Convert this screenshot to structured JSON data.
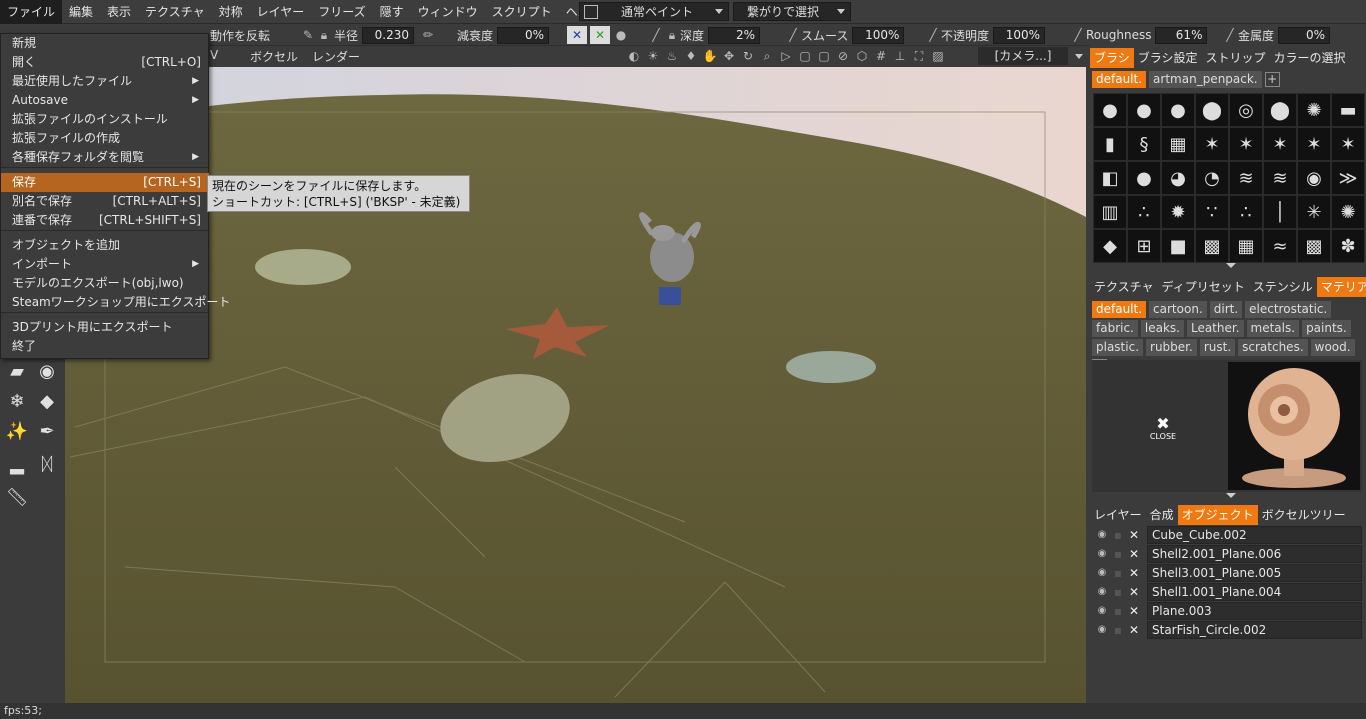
{
  "menubar": {
    "items": [
      "ファイル",
      "編集",
      "表示",
      "テクスチャ",
      "対称",
      "レイヤー",
      "フリーズ",
      "隠す",
      "ウィンドウ",
      "スクリプト",
      "ヘルプ"
    ],
    "paint_mode": "通常ペイント",
    "selection_mode": "繋がりで選択"
  },
  "toolbar": {
    "partial_left": "動作を反転",
    "radius_label": "半径",
    "radius_value": "0.230",
    "falloff_label": "減衰度",
    "falloff_value": "0%",
    "depth_label": "深度",
    "depth_value": "2%",
    "smooth_label": "スムース",
    "smooth_value": "100%",
    "opacity_label": "不透明度",
    "opacity_value": "100%",
    "roughness_label": "Roughness",
    "roughness_value": "61%",
    "metal_label": "金属度",
    "metal_value": "0%"
  },
  "toolbar3": {
    "partial_uv": "V",
    "voxel": "ボクセル",
    "render": "レンダー",
    "camera": "[カメラ...]"
  },
  "file_menu": {
    "items": [
      {
        "label": "新規",
        "shortcut": ""
      },
      {
        "label": "開く",
        "shortcut": "[CTRL+O]"
      },
      {
        "label": "最近使用したファイル",
        "shortcut": "",
        "submenu": true
      },
      {
        "label": "Autosave",
        "shortcut": "",
        "submenu": true
      },
      {
        "label": "拡張ファイルのインストール",
        "shortcut": ""
      },
      {
        "label": "拡張ファイルの作成",
        "shortcut": ""
      },
      {
        "label": "各種保存フォルダを閲覧",
        "shortcut": "",
        "submenu": true
      },
      {
        "label": "保存",
        "shortcut": "[CTRL+S]",
        "highlighted": true
      },
      {
        "label": "別名で保存",
        "shortcut": "[CTRL+ALT+S]"
      },
      {
        "label": "連番で保存",
        "shortcut": "[CTRL+SHIFT+S]"
      },
      {
        "label": "オブジェクトを追加",
        "shortcut": ""
      },
      {
        "label": "インポート",
        "shortcut": "",
        "submenu": true
      },
      {
        "label": "モデルのエクスポート(obj,lwo)",
        "shortcut": ""
      },
      {
        "label": "Steamワークショップ用にエクスポート",
        "shortcut": ""
      },
      {
        "label": "3Dプリント用にエクスポート",
        "shortcut": ""
      },
      {
        "label": "終了",
        "shortcut": ""
      }
    ]
  },
  "tooltip": {
    "line1": "現在のシーンをファイルに保存します。",
    "line2": "ショートカット: [CTRL+S]  ('BKSP' - 未定義)"
  },
  "brush_panel": {
    "tabs": [
      "ブラシ",
      "ブラシ設定",
      "ストリップ",
      "カラーの選択"
    ],
    "active_tab": "ブラシ",
    "libraries": [
      "default.",
      "artman_penpack."
    ],
    "add": "+"
  },
  "material_panel": {
    "tabs": [
      "テクスチャ",
      "ディプリセット",
      "ステンシル",
      "マテリアル"
    ],
    "chips": [
      "default.",
      "cartoon.",
      "dirt.",
      "electrostatic.",
      "fabric.",
      "leaks.",
      "Leather.",
      "metals.",
      "paints.",
      "plastic.",
      "rubber.",
      "rust.",
      "scratches.",
      "wood."
    ],
    "add": "+",
    "close": "CLOSE"
  },
  "layers_panel": {
    "tabs": [
      "レイヤー",
      "合成",
      "オブジェクト",
      "ボクセルツリー"
    ],
    "objects": [
      "Cube_Cube.002",
      "Shell2.001_Plane.006",
      "Shell3.001_Plane.005",
      "Shell1.001_Plane.004",
      "Plane.003",
      "StarFish_Circle.002"
    ]
  },
  "status": {
    "fps": "fps:53;"
  },
  "colors": {
    "accent": "#f07a12",
    "menu_highlight": "#b5651f",
    "background": "#3b3b3b"
  }
}
